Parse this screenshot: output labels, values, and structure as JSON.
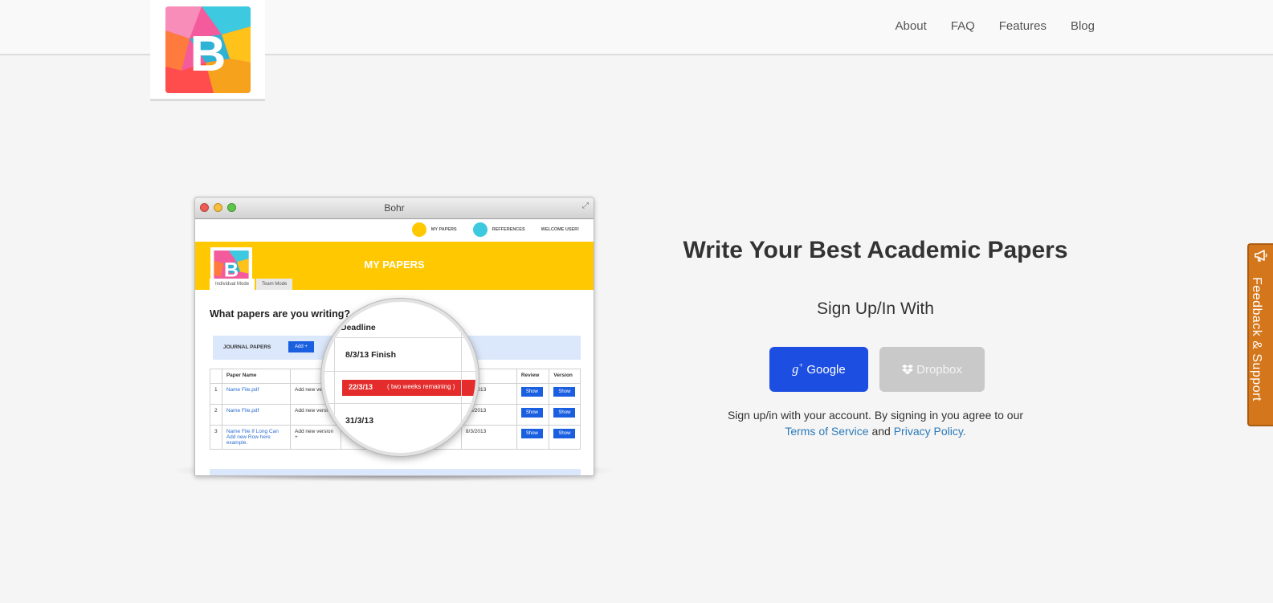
{
  "nav": {
    "items": [
      "About",
      "FAQ",
      "Features",
      "Blog"
    ]
  },
  "logo": {
    "letter": "B"
  },
  "mockup": {
    "window_title": "Bohr",
    "app_nav": [
      "MY PAPERS",
      "REFFERENCES",
      "WELCOME USER!"
    ],
    "banner_title": "MY PAPERS",
    "tabs": [
      "Individual Mode",
      "Team Mode"
    ],
    "question": "What papers are you writing?",
    "section_label": "JOURNAL PAPERS",
    "add_button": "Add +",
    "table": {
      "headers": [
        "",
        "Paper Name",
        "",
        "",
        "Edit",
        "Review",
        "Version"
      ],
      "rows": [
        {
          "num": "1",
          "name": "Name File.pdf",
          "action": "Add new version",
          "edit": "8/3/2013",
          "review": "Show",
          "version": "Show"
        },
        {
          "num": "2",
          "name": "Name File.pdf",
          "action": "Add new version",
          "edit": "8/3/2013",
          "review": "Show",
          "version": "Show"
        },
        {
          "num": "3",
          "name": "Name File If Long Can Add new Row here example.",
          "action": "Add new version +",
          "edit": "8/3/2013",
          "review": "Show",
          "version": "Show"
        }
      ]
    },
    "magnifier": {
      "header": "Deadline",
      "row1": "8/3/13 Finish",
      "alert_date": "22/3/13",
      "alert_note": "( two weeks remaining )",
      "row3": "31/3/13"
    }
  },
  "signup": {
    "headline": "Write Your Best Academic Papers",
    "subheadline": "Sign Up/In With",
    "google_label": "Google",
    "dropbox_label": "Dropbox",
    "legal_text": "Sign up/in with your account. By signing in you agree to our",
    "terms_link": "Terms of Service",
    "and_text": "and",
    "privacy_link": "Privacy Policy."
  },
  "feedback": {
    "label": "Feedback & Support"
  },
  "colors": {
    "google_blue": "#1d4ee2",
    "dropbox_gray": "#c9c9c9",
    "feedback_orange": "#d4771c",
    "mock_yellow": "#ffc800",
    "link_blue": "#2b7ab8"
  },
  "icons": {
    "google": "google-plus-icon",
    "dropbox": "dropbox-icon",
    "feedback": "megaphone-icon"
  }
}
